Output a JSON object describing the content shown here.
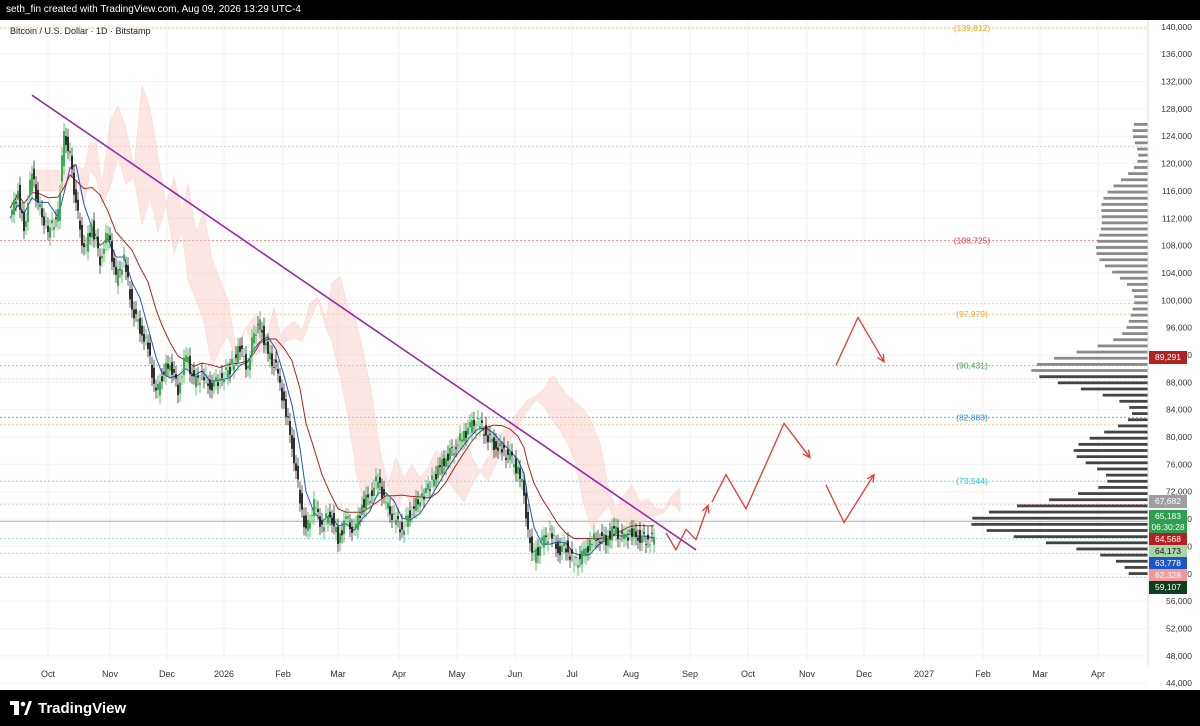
{
  "header": {
    "attribution": "seth_fin created with TradingView.com, Aug 09, 2026 13:29 UTC-4"
  },
  "chart": {
    "symbol_title": "Bitcoin / U.S. Dollar · 1D · Bitstamp"
  },
  "footer": {
    "logo_text": "TradingView",
    "logo_icon": "tradingview-logo-icon"
  },
  "price_tags": [
    {
      "label": "89,291",
      "color": "#b22222"
    },
    {
      "label": "67,682",
      "color": "#9e9e9e"
    },
    {
      "label": "65,183",
      "color": "#2e9e4f"
    },
    {
      "label": "06:30:28",
      "color": "#2e9e4f"
    },
    {
      "label": "64,568",
      "color": "#b22222"
    },
    {
      "label": "64,173",
      "color": "#a5d6a7"
    },
    {
      "label": "63,778",
      "color": "#1e56c8"
    },
    {
      "label": "62,328",
      "color": "#ef9a9a"
    },
    {
      "label": "59,107",
      "color": "#0f3d1f"
    }
  ],
  "chart_data": {
    "type": "candlestick",
    "x_ticks": [
      "Oct",
      "Nov",
      "Dec",
      "2026",
      "Feb",
      "Mar",
      "Apr",
      "May",
      "Jun",
      "Jul",
      "Aug",
      "Sep",
      "Oct",
      "Nov",
      "Dec",
      "2027",
      "Feb",
      "Mar",
      "Apr"
    ],
    "y_ticks": [
      44000,
      48000,
      52000,
      56000,
      60000,
      64000,
      68000,
      72000,
      76000,
      80000,
      84000,
      88000,
      92000,
      96000,
      100000,
      104000,
      108000,
      112000,
      116000,
      120000,
      124000,
      128000,
      132000,
      136000,
      140000
    ],
    "y_tick_labels": [
      "44,000",
      "48,000",
      "52,000",
      "56,000",
      "60,000",
      "64,000",
      "68,000",
      "72,000",
      "76,000",
      "80,000",
      "84,000",
      "88,000",
      "92,000",
      "96,000",
      "100,000",
      "104,000",
      "108,000",
      "112,000",
      "116,000",
      "120,000",
      "124,000",
      "128,000",
      "132,000",
      "136,000",
      "140,000"
    ],
    "ylim": [
      43000,
      141000
    ],
    "level_annotations": [
      {
        "label": "(139,812)",
        "value": 139812,
        "color": "#f5a623"
      },
      {
        "label": "(108,725)",
        "value": 108725,
        "color": "#e53935"
      },
      {
        "label": "(97,979)",
        "value": 97979,
        "color": "#f5a623"
      },
      {
        "label": "(90,431)",
        "value": 90431,
        "color": "#43a047"
      },
      {
        "label": "(82,883)",
        "value": 82883,
        "color": "#1e88e5"
      },
      {
        "label": "(73,544)",
        "value": 73544,
        "color": "#26c6da"
      }
    ],
    "price_series": [
      {
        "t": 0,
        "c": 112000
      },
      {
        "t": 8,
        "c": 116000
      },
      {
        "t": 14,
        "c": 110000
      },
      {
        "t": 22,
        "c": 119000
      },
      {
        "t": 28,
        "c": 114000
      },
      {
        "t": 38,
        "c": 110000
      },
      {
        "t": 48,
        "c": 112500
      },
      {
        "t": 54,
        "c": 124500
      },
      {
        "t": 60,
        "c": 121000
      },
      {
        "t": 66,
        "c": 114000
      },
      {
        "t": 74,
        "c": 107000
      },
      {
        "t": 82,
        "c": 111000
      },
      {
        "t": 90,
        "c": 106000
      },
      {
        "t": 98,
        "c": 110000
      },
      {
        "t": 106,
        "c": 103000
      },
      {
        "t": 114,
        "c": 106000
      },
      {
        "t": 122,
        "c": 99000
      },
      {
        "t": 130,
        "c": 96000
      },
      {
        "t": 138,
        "c": 93000
      },
      {
        "t": 146,
        "c": 86000
      },
      {
        "t": 152,
        "c": 89000
      },
      {
        "t": 160,
        "c": 91000
      },
      {
        "t": 168,
        "c": 87000
      },
      {
        "t": 176,
        "c": 92000
      },
      {
        "t": 184,
        "c": 88000
      },
      {
        "t": 192,
        "c": 89000
      },
      {
        "t": 200,
        "c": 87500
      },
      {
        "t": 210,
        "c": 88500
      },
      {
        "t": 220,
        "c": 90000
      },
      {
        "t": 230,
        "c": 93000
      },
      {
        "t": 238,
        "c": 90000
      },
      {
        "t": 244,
        "c": 95500
      },
      {
        "t": 250,
        "c": 96500
      },
      {
        "t": 258,
        "c": 92000
      },
      {
        "t": 266,
        "c": 90000
      },
      {
        "t": 274,
        "c": 85000
      },
      {
        "t": 282,
        "c": 79000
      },
      {
        "t": 290,
        "c": 71000
      },
      {
        "t": 296,
        "c": 66000
      },
      {
        "t": 304,
        "c": 70000
      },
      {
        "t": 312,
        "c": 67000
      },
      {
        "t": 320,
        "c": 69000
      },
      {
        "t": 328,
        "c": 65000
      },
      {
        "t": 336,
        "c": 68000
      },
      {
        "t": 344,
        "c": 66000
      },
      {
        "t": 352,
        "c": 70000
      },
      {
        "t": 360,
        "c": 71500
      },
      {
        "t": 368,
        "c": 74000
      },
      {
        "t": 376,
        "c": 70000
      },
      {
        "t": 384,
        "c": 68000
      },
      {
        "t": 392,
        "c": 66500
      },
      {
        "t": 400,
        "c": 69000
      },
      {
        "t": 410,
        "c": 71000
      },
      {
        "t": 420,
        "c": 73000
      },
      {
        "t": 428,
        "c": 75000
      },
      {
        "t": 436,
        "c": 77000
      },
      {
        "t": 444,
        "c": 78500
      },
      {
        "t": 452,
        "c": 80000
      },
      {
        "t": 460,
        "c": 81500
      },
      {
        "t": 468,
        "c": 82000
      },
      {
        "t": 476,
        "c": 80500
      },
      {
        "t": 484,
        "c": 79000
      },
      {
        "t": 492,
        "c": 78000
      },
      {
        "t": 500,
        "c": 77000
      },
      {
        "t": 508,
        "c": 75000
      },
      {
        "t": 514,
        "c": 72000
      },
      {
        "t": 518,
        "c": 66000
      },
      {
        "t": 524,
        "c": 62500
      },
      {
        "t": 532,
        "c": 64500
      },
      {
        "t": 540,
        "c": 66000
      },
      {
        "t": 548,
        "c": 63500
      },
      {
        "t": 556,
        "c": 64000
      },
      {
        "t": 564,
        "c": 61500
      },
      {
        "t": 572,
        "c": 62500
      },
      {
        "t": 580,
        "c": 64500
      },
      {
        "t": 588,
        "c": 65500
      },
      {
        "t": 596,
        "c": 65000
      },
      {
        "t": 604,
        "c": 66500
      },
      {
        "t": 612,
        "c": 65000
      },
      {
        "t": 620,
        "c": 66000
      },
      {
        "t": 628,
        "c": 65500
      },
      {
        "t": 636,
        "c": 65000
      },
      {
        "t": 644,
        "c": 65183
      }
    ],
    "trendline": [
      {
        "t": 22,
        "v": 130000
      },
      {
        "t": 686,
        "v": 63500
      }
    ],
    "projection_arrows": [
      [
        {
          "t": 656,
          "v": 66000
        },
        {
          "t": 666,
          "v": 63500
        },
        {
          "t": 676,
          "v": 66500
        },
        {
          "t": 686,
          "v": 65000
        },
        {
          "t": 698,
          "v": 70000
        }
      ],
      [
        {
          "t": 702,
          "v": 70500
        },
        {
          "t": 716,
          "v": 74500
        },
        {
          "t": 736,
          "v": 69500
        },
        {
          "t": 774,
          "v": 82000
        },
        {
          "t": 800,
          "v": 77000
        }
      ],
      [
        {
          "t": 816,
          "v": 73000
        },
        {
          "t": 834,
          "v": 67500
        },
        {
          "t": 864,
          "v": 74500
        }
      ],
      [
        {
          "t": 826,
          "v": 90500
        },
        {
          "t": 848,
          "v": 97500
        },
        {
          "t": 874,
          "v": 91000
        }
      ]
    ]
  }
}
